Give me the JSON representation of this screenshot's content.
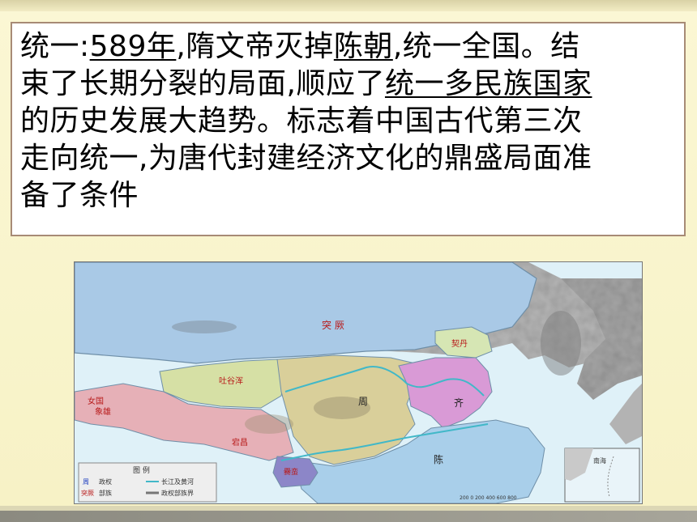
{
  "paragraph": {
    "l1_a": "统一:",
    "l1_b": "589年",
    "l1_c": ",隋文帝灭掉",
    "l1_d": "陈朝",
    "l1_e": ",统一全国。结",
    "l2_a": "束了长期分裂的局面,顺应了",
    "l2_b": "统一多民族国家",
    "l3": "的历史发展大趋势。标志着中国古代第三次",
    "l4": "走向统一,为唐代封建经济文化的鼎盛局面准",
    "l5": "备了条件"
  },
  "map": {
    "regions": {
      "tujue": "突 厥",
      "qidan": "契丹",
      "tuyuhun": "吐谷浑",
      "zhou": "周",
      "qi": "齐",
      "chen": "陈",
      "tibet_a": "女国",
      "tibet_b": "象雄",
      "dangxiang": "宕昌",
      "cuan": "爨蛮"
    },
    "legend": {
      "title": "图 例",
      "regime": "周",
      "regime_text": "政权",
      "tribe": "突厥",
      "tribe_text": "部族",
      "river": "长江及黄河",
      "border": "政权部族界"
    },
    "inset_label": "南海",
    "scale": "200 0 200 400 600 800"
  },
  "colors": {
    "sea": "#dff1f8",
    "tujue": "#a9c9e6",
    "zhou": "#d9cf9a",
    "qi": "#d99ad6",
    "chen": "#a9cfea",
    "tuyuhun": "#d6e0a5",
    "west": "#e6b0b7",
    "qidan": "#d6e6b4"
  }
}
